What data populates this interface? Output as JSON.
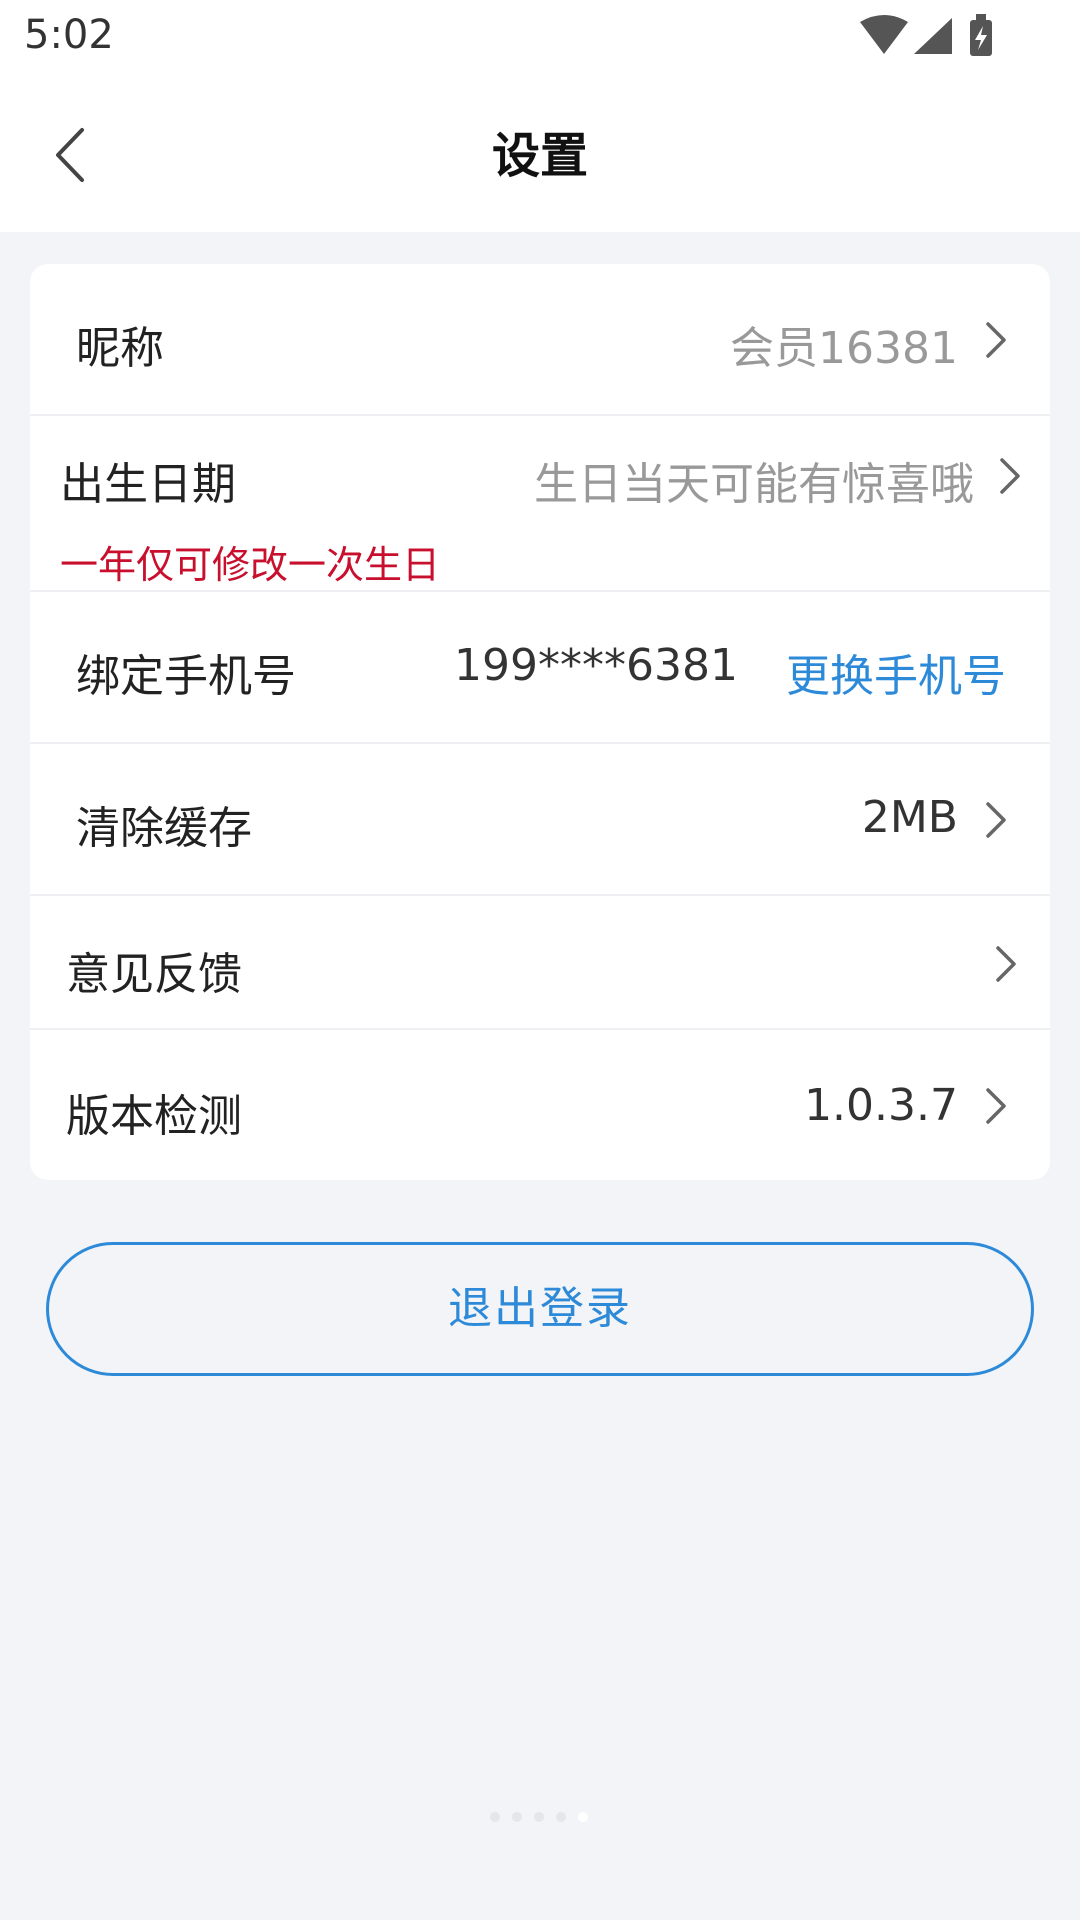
{
  "status_bar": {
    "time": "5:02",
    "icons": [
      "wifi-icon",
      "signal-icon",
      "battery-charging-icon"
    ]
  },
  "header": {
    "title": "设置",
    "back_icon": "chevron-left-icon"
  },
  "settings": {
    "nickname": {
      "label": "昵称",
      "value": "会员16381"
    },
    "birthday": {
      "label": "出生日期",
      "value": "生日当天可能有惊喜哦",
      "note": "一年仅可修改一次生日"
    },
    "phone": {
      "label": "绑定手机号",
      "value": "199****6381",
      "action": "更换手机号"
    },
    "cache": {
      "label": "清除缓存",
      "value": "2MB"
    },
    "feedback": {
      "label": "意见反馈"
    },
    "version": {
      "label": "版本检测",
      "value": "1.0.3.7"
    }
  },
  "logout_label": "退出登录",
  "pager": {
    "count": 5,
    "active_index": 4
  },
  "colors": {
    "accent": "#2d8ad8",
    "warning": "#c8102e",
    "background": "#f2f4f7"
  }
}
